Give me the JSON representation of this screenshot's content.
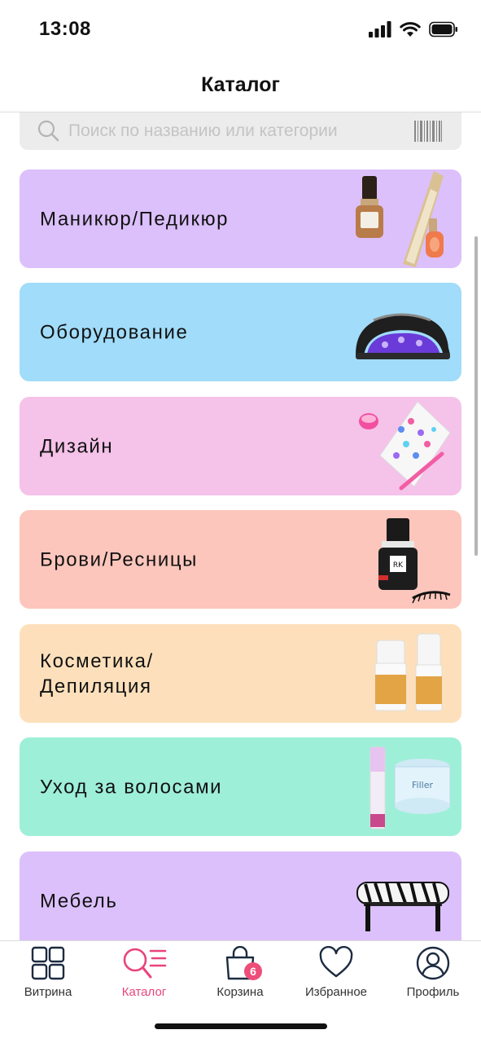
{
  "status": {
    "time": "13:08"
  },
  "header": {
    "title": "Каталог"
  },
  "search": {
    "placeholder": "Поиск по названию или категории",
    "value": ""
  },
  "categories": [
    {
      "label": "Маникюр/Педикюр",
      "color": "#dcc0fb",
      "icon": "nail-polish-products"
    },
    {
      "label": "Оборудование",
      "color": "#a1dcfa",
      "icon": "uv-lamp"
    },
    {
      "label": "Дизайн",
      "color": "#f5c2e9",
      "icon": "nail-stickers"
    },
    {
      "label": "Брови/Ресницы",
      "color": "#fcc6bc",
      "icon": "lash-glue"
    },
    {
      "label": "Косметика/\nДепиляция",
      "color": "#fde0bb",
      "icon": "cosmetic-bottles"
    },
    {
      "label": "Уход за волосами",
      "color": "#9eefd8",
      "icon": "hair-care-products"
    },
    {
      "label": "Мебель",
      "color": "#dcc0fb",
      "icon": "zebra-stool"
    }
  ],
  "tabbar": {
    "items": [
      {
        "label": "Витрина",
        "icon": "grid-icon"
      },
      {
        "label": "Каталог",
        "icon": "catalog-search-icon",
        "active": true
      },
      {
        "label": "Корзина",
        "icon": "bag-icon",
        "badge": "6"
      },
      {
        "label": "Избранное",
        "icon": "heart-icon"
      },
      {
        "label": "Профиль",
        "icon": "profile-icon"
      }
    ],
    "accent_color": "#e8457a"
  }
}
